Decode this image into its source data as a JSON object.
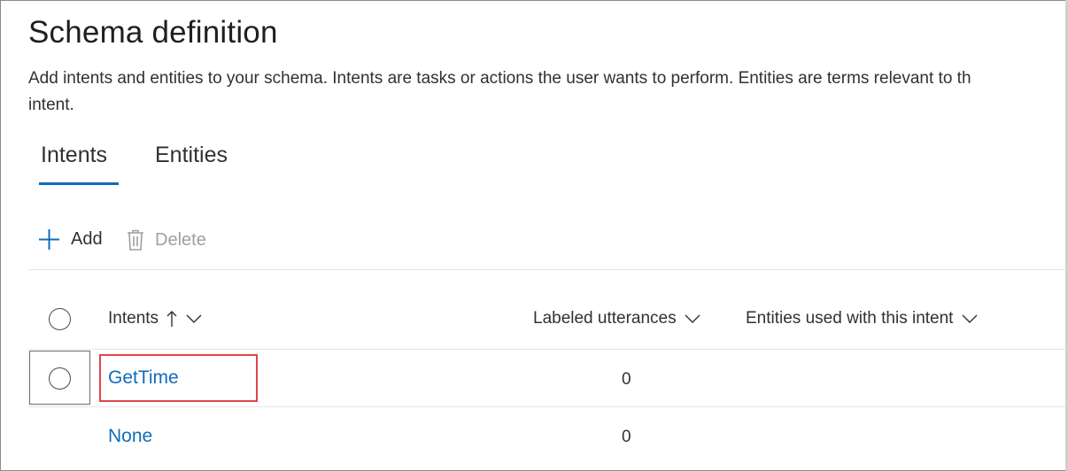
{
  "page": {
    "title": "Schema definition",
    "description_line1": "Add intents and entities to your schema. Intents are tasks or actions the user wants to perform. Entities are terms relevant to th",
    "description_line2": "intent."
  },
  "tabs": [
    {
      "label": "Intents",
      "selected": true
    },
    {
      "label": "Entities",
      "selected": false
    }
  ],
  "toolbar": {
    "add_label": "Add",
    "delete_label": "Delete"
  },
  "table": {
    "columns": {
      "intents": "Intents",
      "labeled_utterances": "Labeled utterances",
      "entities_used": "Entities used with this intent"
    },
    "rows": [
      {
        "intent": "GetTime",
        "labeled_utterances": "0",
        "entities_used": ""
      },
      {
        "intent": "None",
        "labeled_utterances": "0",
        "entities_used": ""
      }
    ]
  },
  "colors": {
    "accent": "#0f6cbd",
    "highlight": "#e0454a",
    "disabled": "#a19f9d"
  },
  "icons": [
    "plus-icon",
    "trash-icon",
    "sort-up-arrow-icon",
    "chevron-down-icon",
    "radio-circle-icon"
  ]
}
